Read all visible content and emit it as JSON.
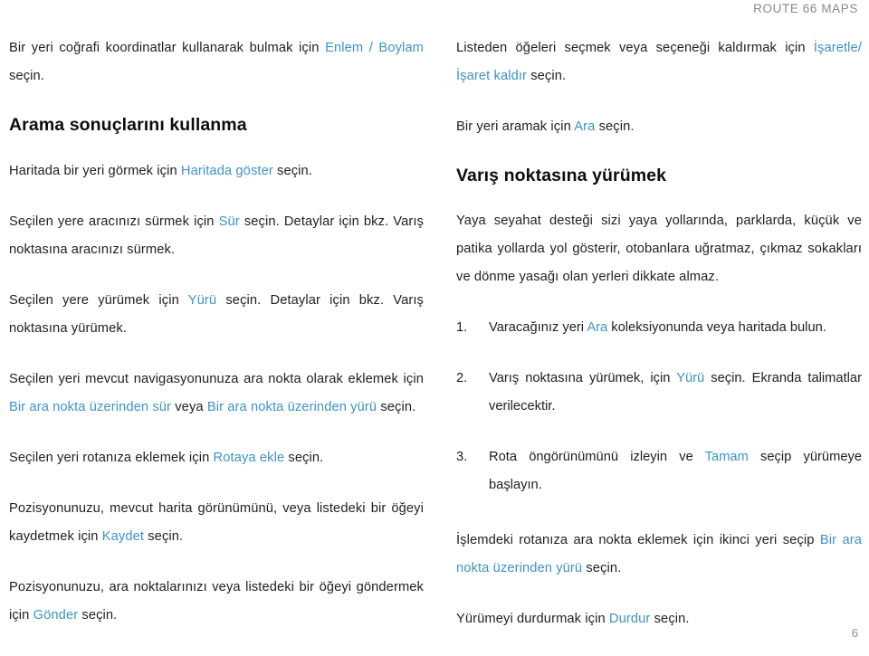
{
  "header": {
    "running_head": "ROUTE 66 MAPS"
  },
  "footer": {
    "page_number": "6"
  },
  "colors": {
    "link": "#3e93c8",
    "body_text": "#1f1f1f",
    "header_text": "#8a8a8a"
  },
  "left_column": {
    "p1": {
      "t1": "Bir yeri coğrafi koordinatlar kullanarak bulmak için ",
      "link1": "Enlem / Boylam",
      "t2": " seçin."
    },
    "heading": "Arama sonuçlarını kullanma",
    "p2": {
      "t1": "Haritada bir yeri görmek için ",
      "link1": "Haritada göster",
      "t2": " seçin."
    },
    "p3": {
      "t1": "Seçilen yere aracınızı sürmek için ",
      "link1": "Sür",
      "t2": " seçin. Detaylar için bkz. Varış noktasına aracınızı sürmek."
    },
    "p4": {
      "t1": "Seçilen yere yürümek için ",
      "link1": "Yürü",
      "t2": " seçin. Detaylar için bkz. Varış noktasına yürümek."
    },
    "p5": {
      "t1": "Seçilen yeri mevcut navigasyonunuza ara nokta olarak eklemek için ",
      "link1": "Bir ara nokta üzerinden sür",
      "t2": " veya ",
      "link2": "Bir ara nokta üzerinden yürü",
      "t3": " seçin."
    },
    "p6": {
      "t1": "Seçilen yeri rotanıza eklemek için ",
      "link1": "Rotaya ekle",
      "t2": " seçin."
    },
    "p7": {
      "t1": "Pozisyonunuzu, mevcut harita görünümünü, veya listedeki bir öğeyi kaydetmek için ",
      "link1": "Kaydet",
      "t2": " seçin."
    },
    "p8": {
      "t1": "Pozisyonunuzu, ara noktalarınızı veya listedeki bir öğeyi göndermek için ",
      "link1": "Gönder",
      "t2": " seçin."
    }
  },
  "right_column": {
    "p1": {
      "t1": "Listeden öğeleri seçmek veya seçeneği kaldırmak için ",
      "link1": "İşaretle/ İşaret kaldır",
      "t2": " seçin."
    },
    "p2": {
      "t1": "Bir yeri aramak için ",
      "link1": "Ara",
      "t2": " seçin."
    },
    "heading": "Varış noktasına yürümek",
    "p3": {
      "t1": "Yaya seyahat desteği sizi yaya yollarında, parklarda, küçük ve patika yollarda yol gösterir, otobanlara uğratmaz, çıkmaz sokakları ve dönme yasağı olan yerleri dikkate almaz."
    },
    "steps": [
      {
        "number": "1.",
        "t1": "Varacağınız yeri ",
        "link1": "Ara",
        "t2": " koleksiyonunda veya haritada bulun."
      },
      {
        "number": "2.",
        "t1": "Varış noktasına yürümek, için ",
        "link1": "Yürü",
        "t2": " seçin. Ekranda talimatlar verilecektir."
      },
      {
        "number": "3.",
        "t1": "Rota öngörünümünü izleyin ve ",
        "link1": "Tamam",
        "t2": " seçip yürümeye başlayın."
      }
    ],
    "p4": {
      "t1": "İşlemdeki rotanıza ara nokta eklemek için ikinci yeri seçip ",
      "link1": "Bir ara nokta üzerinden yürü",
      "t2": " seçin."
    },
    "p5": {
      "t1": "Yürümeyi durdurmak için ",
      "link1": "Durdur",
      "t2": " seçin."
    }
  }
}
